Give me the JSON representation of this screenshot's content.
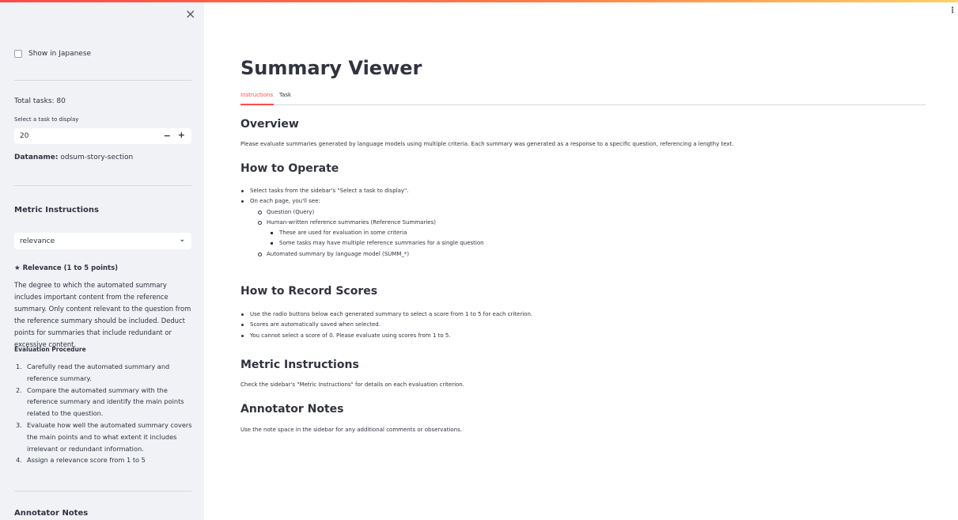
{
  "sidebar": {
    "close_icon": "×",
    "show_japanese": "Show in Japanese",
    "total_tasks": "Total tasks: 80",
    "select_task_label": "Select a task to display",
    "task_value": "20",
    "minus": "−",
    "plus": "+",
    "dataname_label": "Dataname:",
    "dataname_value": " odsum-story-section",
    "metric_heading": "Metric Instructions",
    "metric_select": "relevance",
    "chevron": "⌄",
    "relevance_title": "★ Relevance (1 to 5 points)",
    "relevance_body": "The degree to which the automated summary includes important content from the reference summary. Only content relevant to the question from the reference summary should be included. Deduct points for summaries that include redundant or excessive content.",
    "eval_procedure": "Evaluation Procedure",
    "procedure": [
      {
        "num": "1.",
        "text": "Carefully read the automated summary and reference summary."
      },
      {
        "num": "2.",
        "text": "Compare the automated summary with the reference summary and identify the main points related to the question."
      },
      {
        "num": "3.",
        "text": "Evaluate how well the automated summary covers the main points and to what extent it includes irrelevant or redundant information."
      },
      {
        "num": "4.",
        "text": "Assign a relevance score from 1 to 5"
      }
    ],
    "annotator_heading": "Annotator Notes"
  },
  "header": {
    "menu_icon": "⋮"
  },
  "main": {
    "title": "Summary Viewer",
    "tabs": [
      {
        "label": "Instructions",
        "active": true
      },
      {
        "label": "Task",
        "active": false
      }
    ],
    "overview_heading": "Overview",
    "overview_text": "Please evaluate summaries generated by language models using multiple criteria. Each summary was generated as a response to a specific question, referencing a lengthy text.",
    "operate_heading": "How to Operate",
    "operate_items": [
      {
        "level": 1,
        "text": "Select tasks from the sidebar's \"Select a task to display\"."
      },
      {
        "level": 1,
        "text": "On each page, you'll see:"
      },
      {
        "level": 2,
        "text": "Question (Query)"
      },
      {
        "level": 2,
        "text": "Human-written reference summaries (Reference Summaries)"
      },
      {
        "level": 3,
        "text": "These are used for evaluation in some criteria"
      },
      {
        "level": 3,
        "text": "Some tasks may have multiple reference summaries for a single question"
      },
      {
        "level": 2,
        "text": "Automated summary by language model (SUMM_*)"
      }
    ],
    "record_heading": "How to Record Scores",
    "record_items": [
      "Use the radio buttons below each generated summary to select a score from 1 to 5 for each criterion.",
      "Scores are automatically saved when selected.",
      "You cannot select a score of 0. Please evaluate using scores from 1 to 5."
    ],
    "metric_heading": "Metric Instructions",
    "metric_text": "Check the sidebar's \"Metric Instructions\" for details on each evaluation criterion.",
    "notes_heading": "Annotator Notes",
    "notes_text": "Use the note space in the sidebar for any additional comments or observations."
  },
  "colors": {
    "accent": "#ff4b4b",
    "sidebar_bg": "#f0f2f6",
    "text": "#31333f"
  }
}
